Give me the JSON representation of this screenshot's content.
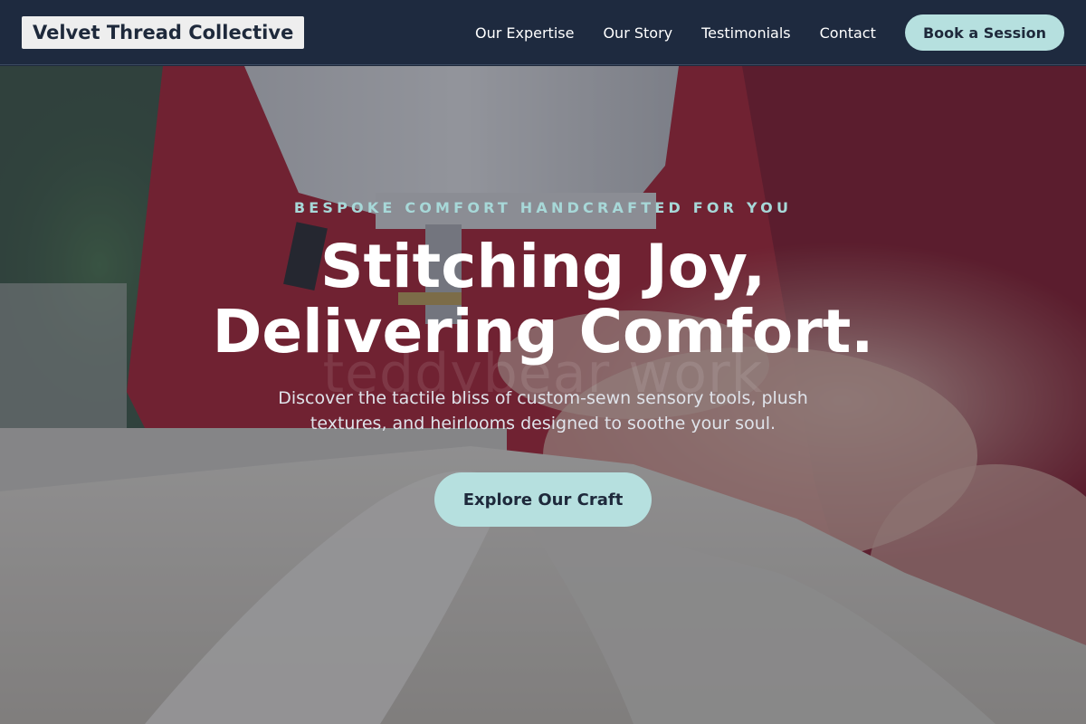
{
  "header": {
    "logo": "Velvet Thread Collective",
    "nav": [
      {
        "label": "Our Expertise"
      },
      {
        "label": "Our Story"
      },
      {
        "label": "Testimonials"
      },
      {
        "label": "Contact"
      }
    ],
    "cta_label": "Book a Session"
  },
  "hero": {
    "eyebrow": "BESPOKE COMFORT HANDCRAFTED FOR YOU",
    "headline_line1": "Stitching Joy,",
    "headline_line2": "Delivering Comfort.",
    "watermark": "teddybear work",
    "subtext": "Discover the tactile bliss of custom-sewn sensory tools, plush textures, and heirlooms designed to soothe your soul.",
    "cta_label": "Explore Our Craft",
    "background_image": "sewing-machine-photo"
  },
  "colors": {
    "header_bg": "#1e2a3f",
    "accent": "#b6e0df",
    "eyebrow": "#a7d8d8",
    "text_dark": "#1e293b"
  }
}
